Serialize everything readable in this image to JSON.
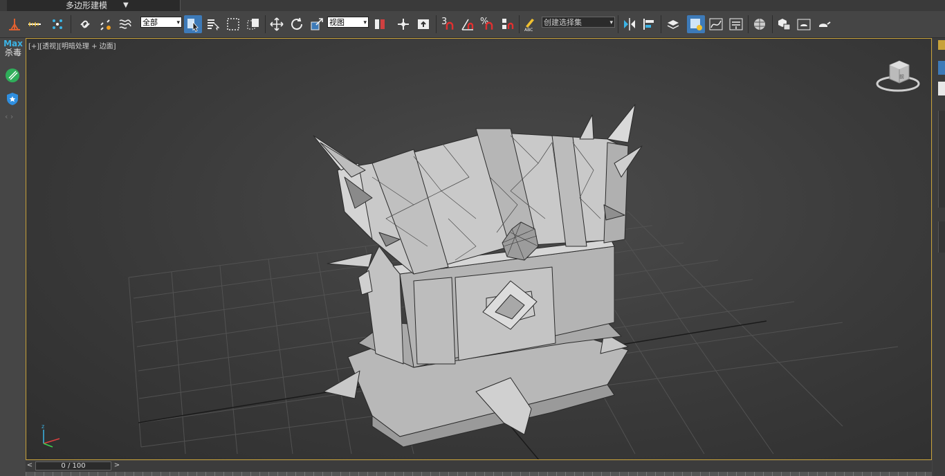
{
  "ribbon": {
    "tab_label": "多边形建模"
  },
  "toolbar": {
    "selection_filter": "全部",
    "reference_coord": "视图",
    "named_selection_placeholder": "创建选择集",
    "snap_label": "3",
    "percent_snap_label": "%"
  },
  "left_bar": {
    "logo_line1": "Max",
    "logo_line2": "杀毒"
  },
  "viewport": {
    "label": "[+][透视][明暗处理 + 边面]",
    "viewcube_label": "前",
    "axis_z": "z"
  },
  "timeline": {
    "frame": "0 / 100",
    "prev": "<",
    "next": ">"
  },
  "colors": {
    "accent": "#3d7ab8",
    "viewport_border": "#c8a23a",
    "logo": "#3bb4e6"
  }
}
